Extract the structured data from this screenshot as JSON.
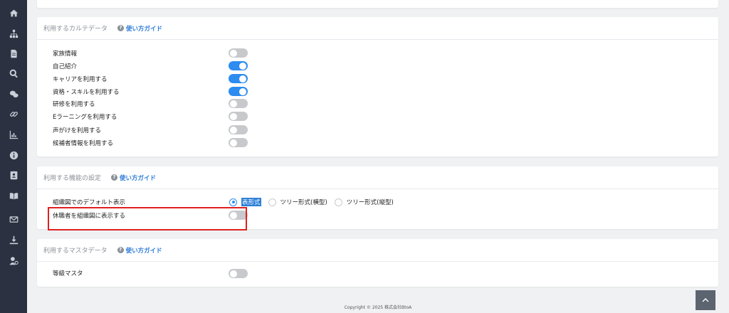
{
  "sidebar": {
    "icons": [
      "home-icon",
      "org-chart-icon",
      "document-icon",
      "search-icon",
      "chat-icon",
      "link-icon",
      "chart-icon",
      "info-icon",
      "contact-book-icon",
      "book-icon",
      "mail-icon",
      "download-icon",
      "user-settings-icon"
    ]
  },
  "sections": {
    "karte": {
      "title": "利用するカルテデータ",
      "guide": "使い方ガイド",
      "items": [
        {
          "label": "家族情報",
          "on": false
        },
        {
          "label": "自己紹介",
          "on": true
        },
        {
          "label": "キャリアを利用する",
          "on": true
        },
        {
          "label": "資格・スキルを利用する",
          "on": true
        },
        {
          "label": "研修を利用する",
          "on": false
        },
        {
          "label": "Eラーニングを利用する",
          "on": false
        },
        {
          "label": "声がけを利用する",
          "on": false
        },
        {
          "label": "候補者情報を利用する",
          "on": false
        }
      ]
    },
    "features": {
      "title": "利用する機能の設定",
      "guide": "使い方ガイド",
      "org_default_label": "組織図でのデフォルト表示",
      "radio_options": [
        "表形式",
        "ツリー形式(横型)",
        "ツリー形式(縦型)"
      ],
      "selected_radio": "表形式",
      "leave_label": "休職者を組織図に表示する",
      "leave_on": false
    },
    "master": {
      "title": "利用するマスタデータ",
      "guide": "使い方ガイド",
      "grade_label": "等級マスタ",
      "grade_on": false
    }
  },
  "footer": {
    "copyright": "Copyright © 2025 株式会社BtoA"
  },
  "colors": {
    "accent": "#2d8cf0",
    "sidebar": "#2b3140",
    "highlight": "#e02020"
  }
}
